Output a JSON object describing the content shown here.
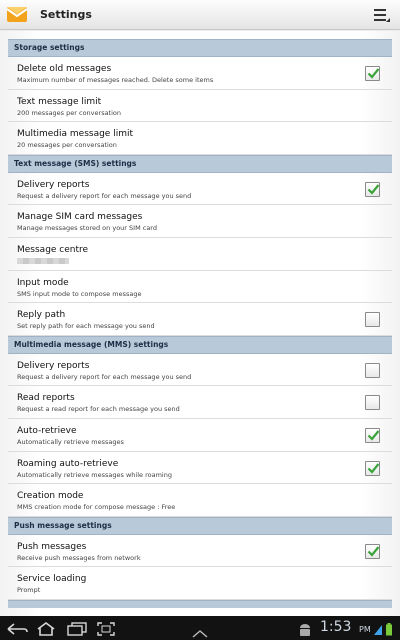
{
  "app": {
    "title": "Settings"
  },
  "sections": [
    {
      "header": "Storage settings",
      "items": [
        {
          "title": "Delete old messages",
          "subtitle": "Maximum number of messages reached. Delete some items",
          "checkbox": true,
          "checked": true
        },
        {
          "title": "Text message limit",
          "subtitle": "200 messages per conversation"
        },
        {
          "title": "Multimedia message limit",
          "subtitle": "20 messages per conversation"
        }
      ]
    },
    {
      "header": "Text message (SMS) settings",
      "items": [
        {
          "title": "Delivery reports",
          "subtitle": "Request a delivery report for each message you send",
          "checkbox": true,
          "checked": true
        },
        {
          "title": "Manage SIM card messages",
          "subtitle": "Manage messages stored on your SIM card"
        },
        {
          "title": "Message centre",
          "subtitle": "",
          "blurred": true
        },
        {
          "title": "Input mode",
          "subtitle": "SMS input mode to compose message"
        },
        {
          "title": "Reply path",
          "subtitle": "Set reply path for each message you send",
          "checkbox": true,
          "checked": false
        }
      ]
    },
    {
      "header": "Multimedia message (MMS) settings",
      "items": [
        {
          "title": "Delivery reports",
          "subtitle": "Request a delivery report for each message you send",
          "checkbox": true,
          "checked": false
        },
        {
          "title": "Read reports",
          "subtitle": "Request a read report for each message you send",
          "checkbox": true,
          "checked": false
        },
        {
          "title": "Auto-retrieve",
          "subtitle": "Automatically retrieve messages",
          "checkbox": true,
          "checked": true
        },
        {
          "title": "Roaming auto-retrieve",
          "subtitle": "Automatically retrieve messages while roaming",
          "checkbox": true,
          "checked": true
        },
        {
          "title": "Creation mode",
          "subtitle": "MMS creation mode for compose message : Free"
        }
      ]
    },
    {
      "header": "Push message settings",
      "items": [
        {
          "title": "Push messages",
          "subtitle": "Receive push messages from network",
          "checkbox": true,
          "checked": true
        },
        {
          "title": "Service loading",
          "subtitle": "Prompt"
        }
      ]
    }
  ],
  "status_bar": {
    "time": "1:53",
    "ampm": "PM"
  },
  "colors": {
    "header_bg": "#b8c9da",
    "check": "#3aa43a",
    "navbar": "#121212"
  }
}
